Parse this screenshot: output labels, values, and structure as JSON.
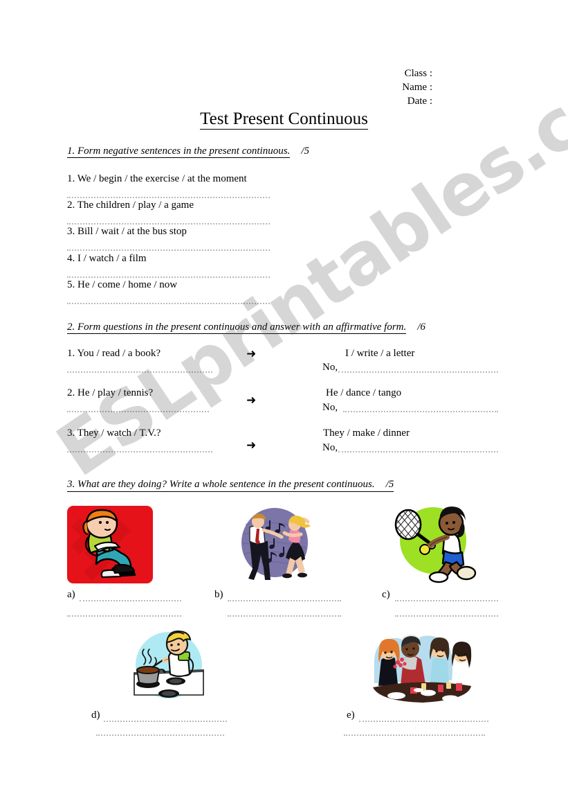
{
  "document": {
    "title": "Test Present Continuous",
    "header_fields": [
      "Class :",
      "Name :",
      "Date :"
    ],
    "watermark": "ESLprintables.com",
    "background_color": "#ffffff",
    "text_color": "#000000",
    "dotted_line_color": "#b9b9b9"
  },
  "exercise1": {
    "heading": "1. Form negative sentences in the present continuous.",
    "points": "/5",
    "items": [
      "1. We / begin / the exercise / at the moment",
      "2. The children / play / a game",
      "3. Bill / wait / at the bus stop",
      "4. I / watch / a film",
      "5. He / come / home / now"
    ]
  },
  "exercise2": {
    "heading": "2. Form questions in the present continuous and answer with an affirmative form.",
    "points": "/6",
    "arrow_glyph": "➜",
    "rows": [
      {
        "question": "1. You / read / a book?",
        "prompt": "I / write / a letter",
        "answer_prefix": "No,"
      },
      {
        "question": "2. He / play / tennis?",
        "prompt": "He / dance / tango",
        "answer_prefix": "No,"
      },
      {
        "question": "3. They / watch / T.V.?",
        "prompt": "They / make / dinner",
        "answer_prefix": "No,"
      }
    ]
  },
  "exercise3": {
    "heading": "3. What are they doing? Write a whole sentence in the present continuous.",
    "points": "/5",
    "pictures": [
      {
        "label": "a)",
        "description": "boy sitting and reading a book",
        "background_color": "#e51219",
        "background_shape": "rounded-square"
      },
      {
        "label": "b)",
        "description": "couple dancing with music notes",
        "background_color": "#7b75a8",
        "background_shape": "ellipse"
      },
      {
        "label": "c)",
        "description": "girl playing tennis",
        "background_color": "#9ee024",
        "background_shape": "circle"
      },
      {
        "label": "d)",
        "description": "person cooking on a stove",
        "background_color": "#aeeaf4",
        "background_shape": "circle"
      },
      {
        "label": "e)",
        "description": "four people eating at a table",
        "background_color": "#b6dcee",
        "background_shape": "cloud"
      }
    ]
  }
}
